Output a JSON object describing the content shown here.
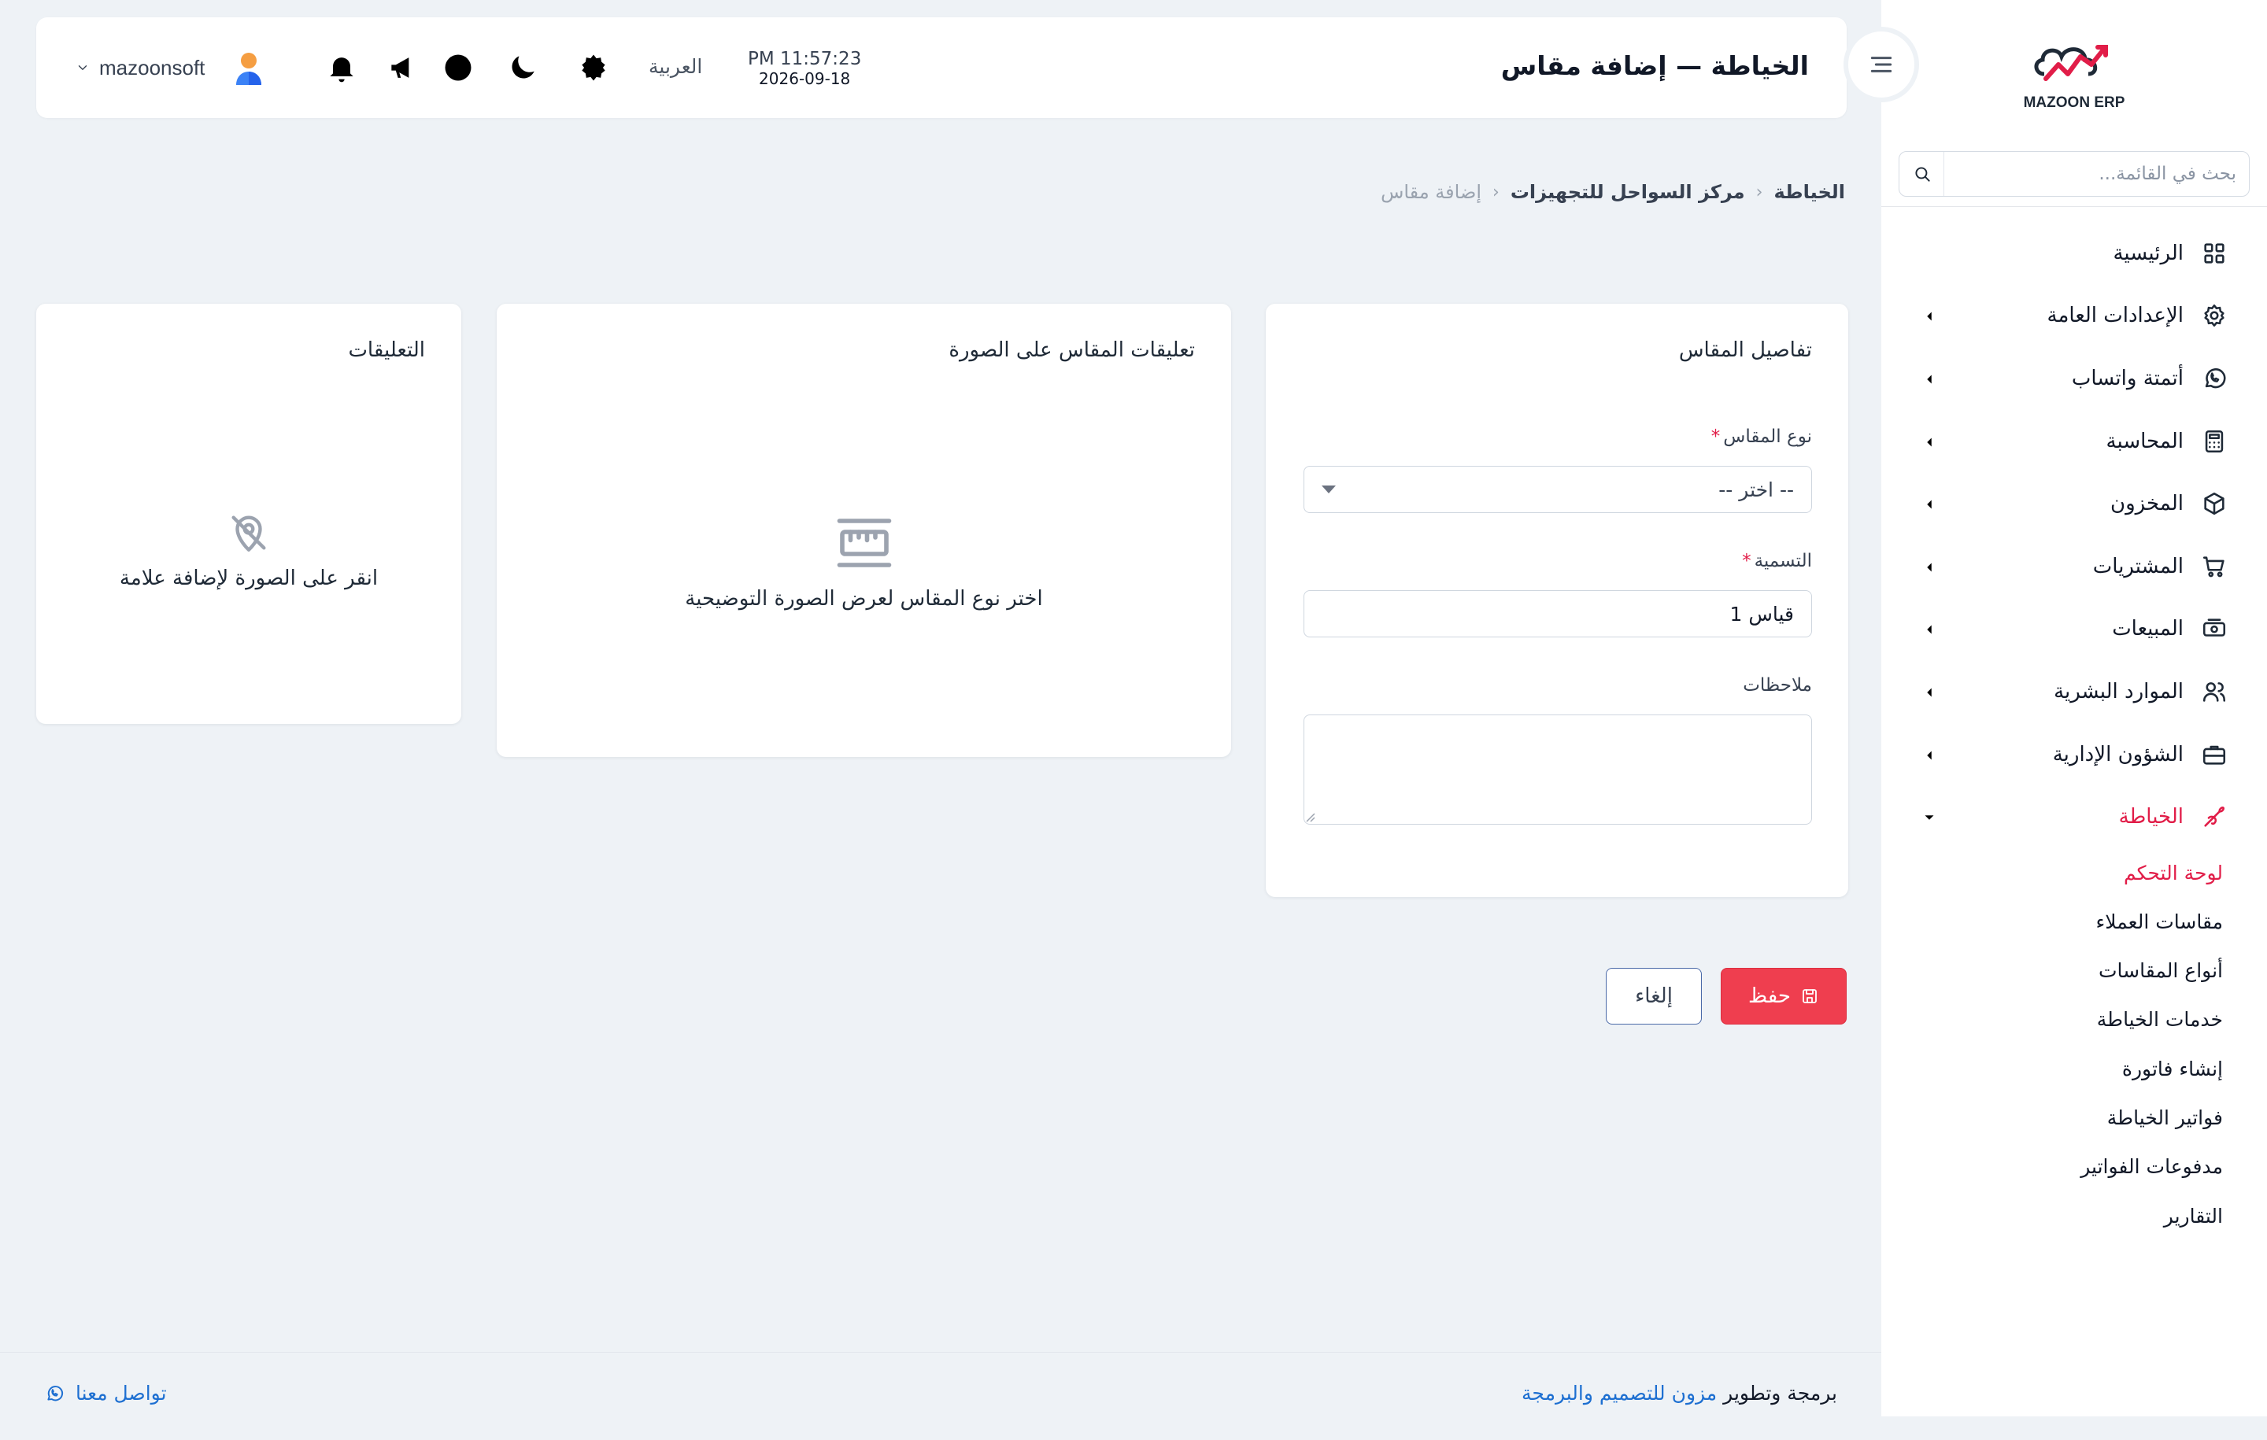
{
  "sidebar": {
    "logo_text": "MAZOON ERP",
    "search_placeholder": "بحث في القائمة...",
    "items": [
      {
        "label": "الرئيسية"
      },
      {
        "label": "الإعدادات العامة"
      },
      {
        "label": "أتمتة واتساب"
      },
      {
        "label": "المحاسبة"
      },
      {
        "label": "المخزون"
      },
      {
        "label": "المشتريات"
      },
      {
        "label": "المبيعات"
      },
      {
        "label": "الموارد البشرية"
      },
      {
        "label": "الشؤون الإدارية"
      },
      {
        "label": "الخياطة"
      }
    ],
    "subitems": [
      {
        "label": "لوحة التحكم"
      },
      {
        "label": "مقاسات العملاء"
      },
      {
        "label": "أنواع المقاسات"
      },
      {
        "label": "خدمات الخياطة"
      },
      {
        "label": "إنشاء فاتورة"
      },
      {
        "label": "فواتير الخياطة"
      },
      {
        "label": "مدفوعات الفواتير"
      },
      {
        "label": "التقارير"
      }
    ]
  },
  "header": {
    "title": "الخياطة — إضافة مقاس",
    "time": "PM 11:57:23",
    "date": "2026-09-18",
    "language": "العربية",
    "username": "mazoonsoft"
  },
  "breadcrumb": {
    "c1": "الخياطة",
    "c2": "مركز السواحل للتجهيزات",
    "c3": "إضافة مقاس"
  },
  "details": {
    "title": "تفاصيل المقاس",
    "type_label": "نوع المقاس",
    "type_value": "-- اختر --",
    "name_label": "التسمية",
    "name_value": "قياس 1",
    "notes_label": "ملاحظات",
    "notes_value": ""
  },
  "image_card": {
    "title": "تعليقات المقاس على الصورة",
    "message": "اختر نوع المقاس لعرض الصورة التوضيحية"
  },
  "notes_card": {
    "title": "التعليقات",
    "message": "انقر على الصورة لإضافة علامة"
  },
  "actions": {
    "save": "حفظ",
    "cancel": "إلغاء"
  },
  "footer": {
    "credit_prefix": "برمجة وتطوير",
    "credit_brand": "مزون للتصميم والبرمجة",
    "contact": "تواصل معنا"
  },
  "colors": {
    "accent": "#e11d48",
    "save_button": "#ef3e4f",
    "link": "#1d6fd1"
  }
}
